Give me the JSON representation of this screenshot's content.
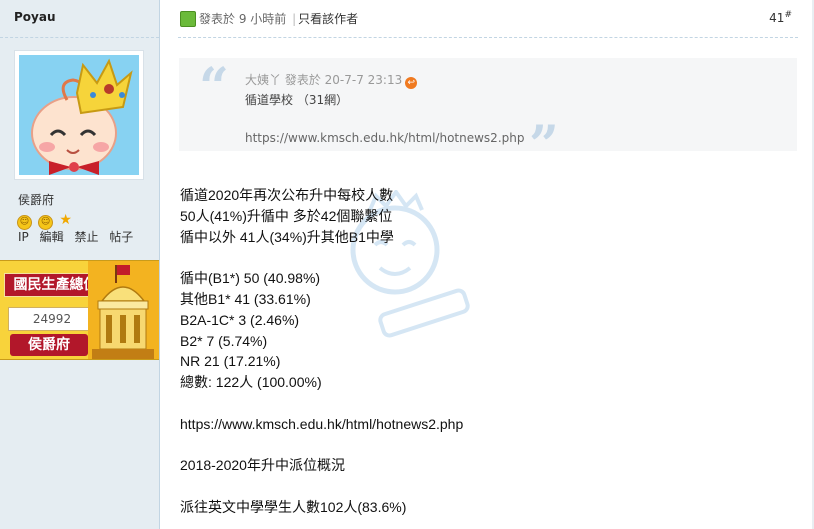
{
  "user": {
    "username": "Poyau",
    "rank": "侯爵府",
    "medals": [
      "smile-medal",
      "smile-medal",
      "star-medal"
    ],
    "actions": [
      "IP",
      "編輯",
      "禁止",
      "帖子"
    ]
  },
  "badge": {
    "title": "國民生產總值",
    "value": "24992",
    "rank": "侯爵府"
  },
  "post": {
    "posted_text": "發表於 9 小時前",
    "author_only": "只看該作者",
    "floor_number": "41",
    "floor_suffix": "#"
  },
  "quote": {
    "author_line": "大姨丫 發表於 20-7-7 23:13",
    "line1": "循道學校 （31網）",
    "line2": "https://www.kmsch.edu.hk/html/hotnews2.php"
  },
  "body_lines": [
    "循道2020年再次公布升中每校人數",
    "50人(41%)升循中 多於42個聯繫位",
    "循中以外 41人(34%)升其他B1中學",
    "",
    "循中(B1*) 50 (40.98%)",
    "其他B1* 41 (33.61%)",
    "B2A-1C* 3 (2.46%)",
    "B2* 7 (5.74%)",
    "NR 21 (17.21%)",
    "總數: 122人 (100.00%)",
    "",
    "https://www.kmsch.edu.hk/html/hotnews2.php",
    "",
    "2018-2020年升中派位概況",
    "",
    "派往英文中學學生人數102人(83.6%)"
  ],
  "colors": {
    "sidebar_bg": "#e5edf2",
    "badge_bg": "#f8d33b",
    "badge_red": "#b2172a",
    "quote_bg": "#f5f6f7"
  }
}
